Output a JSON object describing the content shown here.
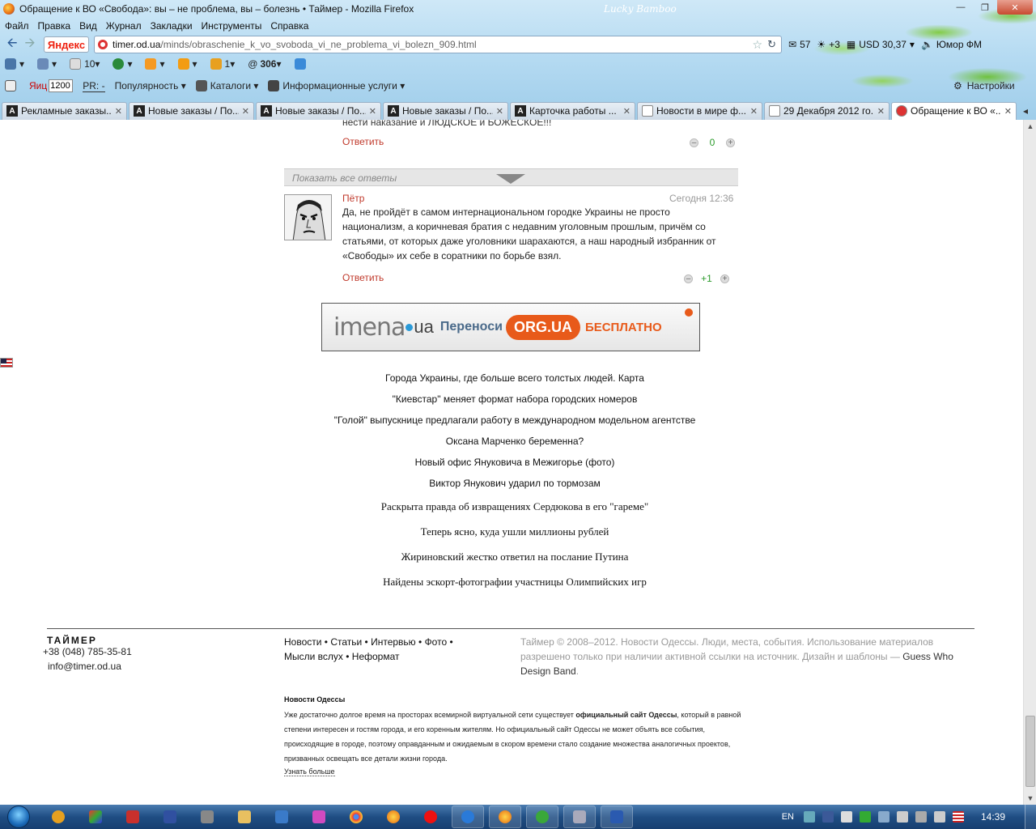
{
  "window": {
    "title": "Обращение к ВО «Свобода»: вы – не проблема, вы – болезнь  • Таймер - Mozilla Firefox",
    "theme_name": "Lucky Bamboo"
  },
  "menu": [
    "Файл",
    "Правка",
    "Вид",
    "Журнал",
    "Закладки",
    "Инструменты",
    "Справка"
  ],
  "navbar": {
    "yandex_label": "Яндекс",
    "url_host": "timer.od.ua",
    "url_path": "/minds/obraschenie_k_vo_svoboda_vi_ne_problema_vi_bolezn_909.html",
    "mail_count": "57",
    "weather": "+3",
    "currency": "USD 30,37",
    "radio": "Юмор ФМ"
  },
  "toolbar2": {
    "count_a": "10",
    "count_b": "1",
    "count_c": "306"
  },
  "toolbar3": {
    "yac_label": "Яиц",
    "yac_value": "1200",
    "pr_label": "PR: -",
    "popularity": "Популярность",
    "catalogs": "Каталоги",
    "info_services": "Информационные услуги",
    "settings": "Настройки"
  },
  "tabs": [
    {
      "label": "Рекламные заказы...",
      "icon": "A"
    },
    {
      "label": "Новые заказы / По...",
      "icon": "A"
    },
    {
      "label": "Новые заказы / По...",
      "icon": "A"
    },
    {
      "label": "Новые заказы / По...",
      "icon": "A"
    },
    {
      "label": "Карточка работы ...",
      "icon": "A"
    },
    {
      "label": "Новости в мире ф...",
      "icon": ""
    },
    {
      "label": "29 Декабря 2012 го...",
      "icon": ""
    },
    {
      "label": "Обращение к ВО «...",
      "icon": "",
      "active": true
    }
  ],
  "prev_comment": {
    "text_tail": "нести наказание и ЛЮДСКОЕ и БОЖЕСКОЕ!!!",
    "reply": "Ответить",
    "score": "0"
  },
  "show_all_answers": "Показать все ответы",
  "comment": {
    "author": "Пётр",
    "date": "Сегодня 12:36",
    "text": "Да, не пройдёт в самом интернациональном городке Украины не просто национализм, а коричневая братия с недавним уголовным прошлым, причём со статьями, от которых даже уголовники шарахаются, а наш народный избранник от «Свободы» их себе в соратники по борьбе взял.",
    "reply": "Ответить",
    "score": "+1"
  },
  "banner": {
    "brand": "imena",
    "brand_domain": "ua",
    "text": "Переноси",
    "badge": "ORG.UA",
    "free": "БЕСПЛАТНО"
  },
  "news_links": [
    "Города Украины, где больше всего толстых людей. Карта",
    "\"Киевстар\" меняет формат набора городских номеров",
    "\"Голой\" выпускнице предлагали работу в международном модельном агентстве",
    "Оксана Марченко беременна?",
    "Новый офис Януковича в Межигорье (фото)",
    "Виктор Янукович ударил по тормозам",
    "Раскрыта правда об извращениях Сердюкова в его \"гареме\"",
    "Теперь ясно, куда ушли миллионы рублей",
    "Жириновский жестко ответил на послание Путина",
    "Найдены эскорт-фотографии участницы Олимпийских игр"
  ],
  "footer": {
    "logo": "ТАЙМЕР",
    "phone": "+38 (048) 785-35-81",
    "email": "info@timer.od.ua",
    "links": [
      "Новости",
      "Статьи",
      "Интервью",
      "Фото",
      "Мысли вслух",
      "Неформат"
    ],
    "copyright": "Таймер © 2008–2012. Новости Одессы. Люди, места, события. Использование материалов разрешено только при наличии активной ссылки на источник. Дизайн и шаблоны —",
    "designer": "Guess Who Design Band",
    "news_heading": "Новости Одессы",
    "news_text_1": "Уже достаточно долгое время на просторах всемирной виртуальной сети существует",
    "news_text_bold": "официальный сайт Одессы",
    "news_text_2": ", который в равной степени интересен и гостям города, и его коренным жителям. Но официальный сайт Одессы не может объять все события, происходящие в городе, поэтому оправданным и ожидаемым в скором времени стало создание множества аналогичных проектов, призванных освещать все детали жизни города.",
    "more": "Узнать больше"
  },
  "taskbar": {
    "lang": "EN",
    "clock": "14:39"
  }
}
